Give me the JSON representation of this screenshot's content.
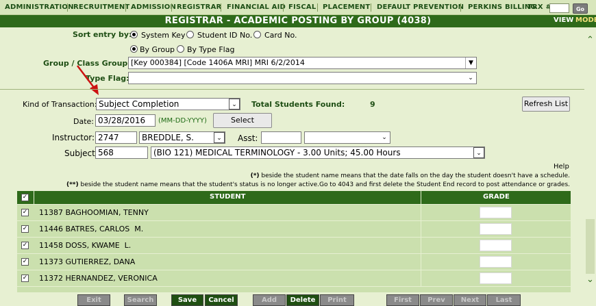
{
  "nav": {
    "items": [
      "ADMINISTRATION",
      "RECRUITMENT",
      "ADMISSION",
      "REGISTRAR",
      "FINANCIAL AID",
      "FISCAL",
      "PLACEMENT",
      "DEFAULT PREVENTION",
      "PERKINS BILLING"
    ],
    "trx_label": "TRX #:",
    "trx_value": "",
    "go_label": "Go"
  },
  "header": {
    "title": "REGISTRAR - ACADEMIC POSTING BY GROUP (4038)",
    "view_label": "VIEW",
    "mode_label": "MODE"
  },
  "sort": {
    "label": "Sort entry by:",
    "options": [
      "System Key",
      "Student ID No.",
      "Card No."
    ],
    "selected": "System Key"
  },
  "group_type": {
    "options": [
      "By Group",
      "By Type Flag"
    ],
    "selected": "By Group"
  },
  "group_class": {
    "label": "Group / Class Group:",
    "value": "[Key 000384] [Code 1406A MRI] MRI 6/2/2014"
  },
  "type_flag": {
    "label": "Type Flag:",
    "value": ""
  },
  "transaction": {
    "label": "Kind of Transaction:",
    "value": "Subject Completion",
    "total_label": "Total Students Found:",
    "total_value": "9",
    "refresh_label": "Refresh List"
  },
  "date": {
    "label": "Date:",
    "value": "03/28/2016",
    "format_hint": "(MM-DD-YYYY)",
    "select_label": "Select"
  },
  "instructor": {
    "label": "Instructor:",
    "code": "2747",
    "name": "BREDDLE, S.",
    "asst_label": "Asst:",
    "asst_code": "",
    "asst_name": ""
  },
  "subject": {
    "label": "Subject:",
    "code": "568",
    "name": "(BIO 121) MEDICAL TERMINOLOGY - 3.00 Units; 45.00 Hours"
  },
  "help": {
    "label": "Help",
    "note1_mark": "(*)",
    "note1": " beside the student name means that the date falls on the day the student doesn't have a schedule.",
    "note2_mark": "(**)",
    "note2": " beside the student name means that the student's status is no longer active.Go to 4043 and first delete the Student End record to post attendance or grades."
  },
  "table": {
    "header_checked": true,
    "columns": [
      "STUDENT",
      "GRADE"
    ],
    "rows": [
      {
        "checked": true,
        "student": "11387 BAGHOOMIAN, TENNY",
        "grade": ""
      },
      {
        "checked": true,
        "student": "11446 BATRES, CARLOS  M.",
        "grade": ""
      },
      {
        "checked": true,
        "student": "11458 DOSS, KWAME  L.",
        "grade": ""
      },
      {
        "checked": true,
        "student": "11373 GUTIERREZ, DANA",
        "grade": ""
      },
      {
        "checked": true,
        "student": "11372 HERNANDEZ, VERONICA",
        "grade": ""
      }
    ]
  },
  "bottom": {
    "exit": "Exit",
    "search": "Search",
    "save": "Save",
    "cancel": "Cancel",
    "add": "Add",
    "delete": "Delete",
    "print": "Print",
    "first": "First",
    "prev": "Prev",
    "next": "Next",
    "last": "Last"
  },
  "colors": {
    "header_green": "#2e6a1a",
    "row_green": "#cbe0ae",
    "background": "#e7f0d2",
    "annotation_arrow": "#cc1111"
  }
}
